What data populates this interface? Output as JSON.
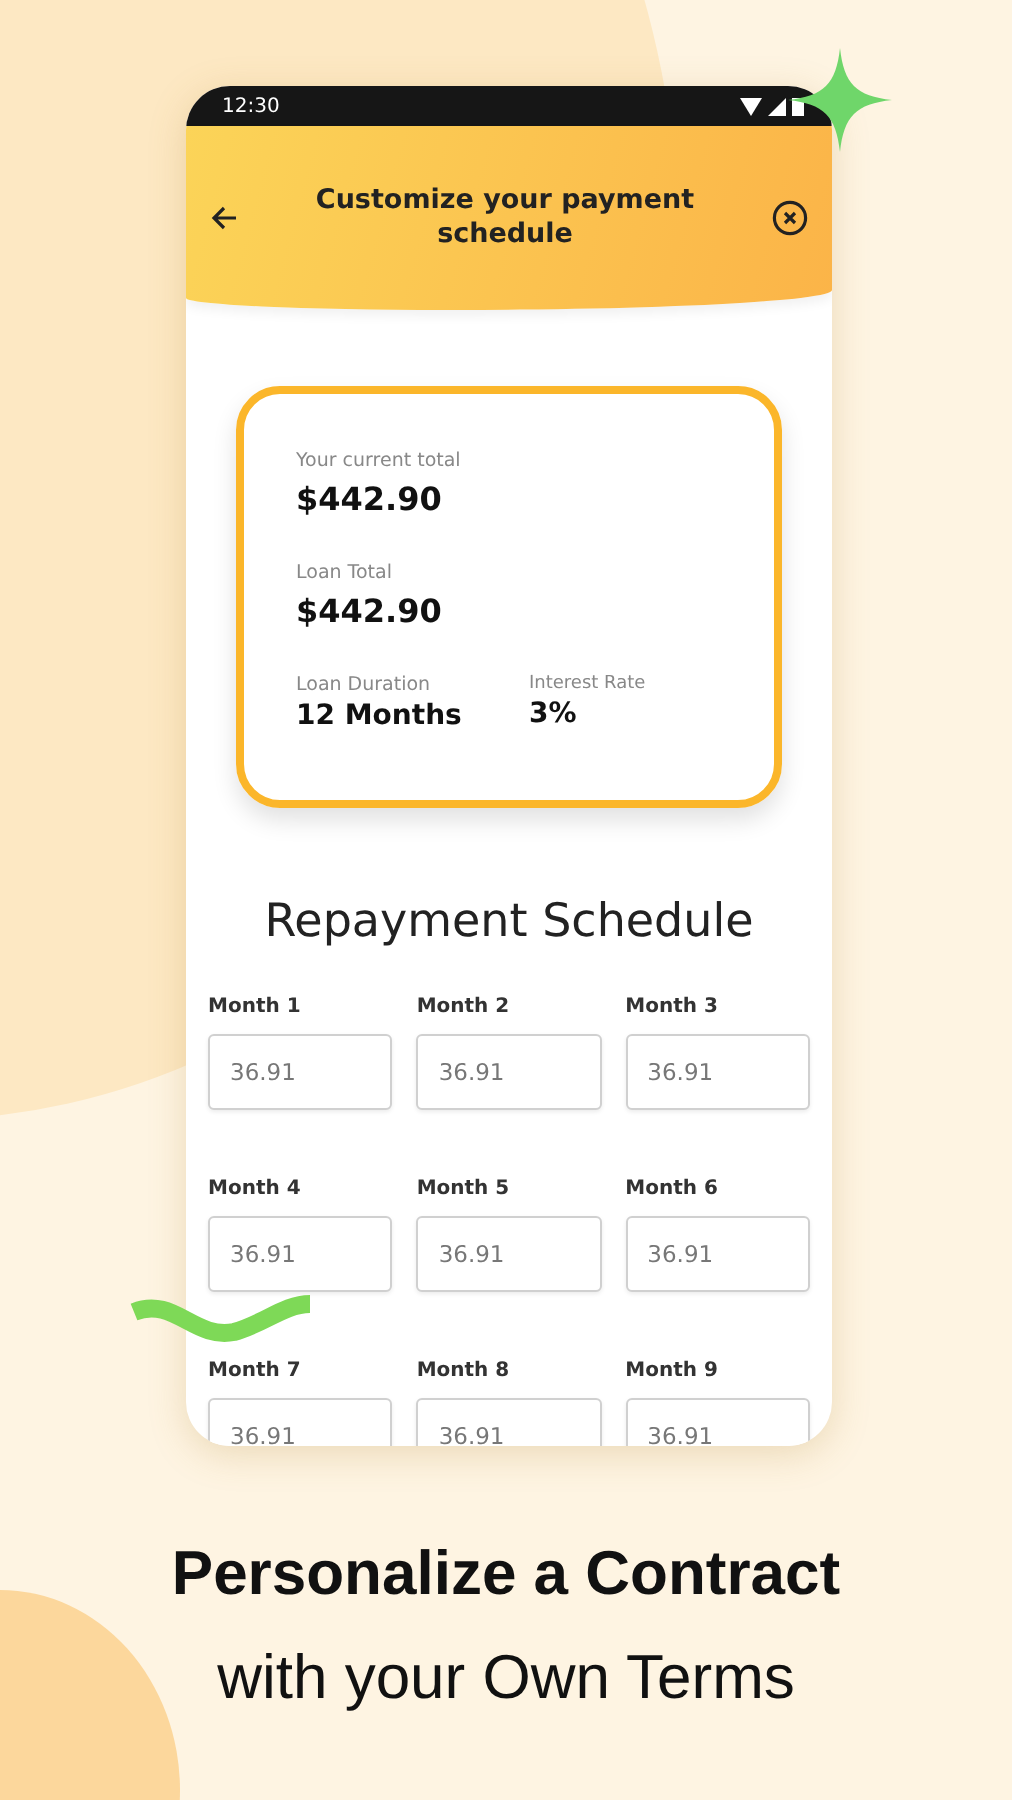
{
  "status_bar": {
    "time": "12:30"
  },
  "header": {
    "title": "Customize your payment schedule"
  },
  "summary": {
    "current_total_label": "Your current total",
    "current_total": "$442.90",
    "loan_total_label": "Loan Total",
    "loan_total": "$442.90",
    "duration_label": "Loan Duration",
    "duration": "12 Months",
    "interest_label": "Interest Rate",
    "interest": "3%"
  },
  "schedule": {
    "title": "Repayment Schedule",
    "months": [
      {
        "label": "Month 1",
        "value": "36.91"
      },
      {
        "label": "Month 2",
        "value": "36.91"
      },
      {
        "label": "Month 3",
        "value": "36.91"
      },
      {
        "label": "Month 4",
        "value": "36.91"
      },
      {
        "label": "Month 5",
        "value": "36.91"
      },
      {
        "label": "Month 6",
        "value": "36.91"
      },
      {
        "label": "Month 7",
        "value": "36.91"
      },
      {
        "label": "Month 8",
        "value": "36.91"
      },
      {
        "label": "Month 9",
        "value": "36.91"
      }
    ]
  },
  "caption": {
    "line_1": "Personalize a Contract",
    "line_2": "with your Own Terms"
  }
}
